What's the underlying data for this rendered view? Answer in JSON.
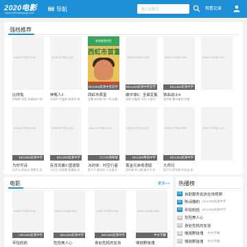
{
  "header": {
    "logo_main": "2020电影",
    "logo_sub": "www.2020dianying.com",
    "nav_label": "导航",
    "search_placeholder": "输入关键词",
    "history_label": "观看记录"
  },
  "featured": {
    "title": "强档推荐",
    "row1": [
      {
        "title": "比得兔",
        "actors": "詹姆斯·柯登,多姆纳尔·格",
        "badge": "",
        "watermark": "www.370dy.com"
      },
      {
        "title": "伸冤人2",
        "actors": "丹泽尔·华盛顿,佩德罗·帕",
        "badge": "",
        "watermark": "www.370dy.com"
      },
      {
        "title": "西虹市首富",
        "actors": "沈腾,宋芸桦,张一鸣,张晨",
        "badge": "BD1280高清中英双字",
        "poster": {
          "tagline": "有钱就是任性",
          "title": "西虹市首富"
        }
      },
      {
        "title": "碟中谍6：全面瓦解",
        "actors": "汤姆·克鲁斯,亨利·卡维尔",
        "badge": "BD1280高清中英双字",
        "watermark": "www.370dy.com"
      },
      {
        "title": "铁血战士4",
        "actors": "波伊德·霍布鲁克,特雷·",
        "badge": "BD1280高清中字",
        "watermark": "www.370dy.com"
      },
      {
        "title": "",
        "actors": "",
        "badge": "",
        "watermark": "www.370dy.com"
      }
    ],
    "row2": [
      {
        "title": "为你写诗",
        "actors": "吴亦凡,郭采洁,周德华,苏",
        "badge": "BD1280高清中字",
        "watermark": "www.370dy.com"
      },
      {
        "title": "反贪风暴3 国语版",
        "actors": "古天乐,张智霖,郑嘉颖,邓",
        "badge": "BD1280高清中字",
        "watermark": "www.370dy.com"
      },
      {
        "title": "冰封侠：时空行者",
        "actors": "甄子丹,黄圣依,王宝强,任",
        "badge": "TC720清晰版",
        "watermark": "www.370dy.com"
      },
      {
        "title": "黄金兄弟粤语版",
        "actors": "郑伊健,陈小春,谢天华,钱",
        "badge": "BD1280粤语中字",
        "watermark": "www.370dy.com"
      },
      {
        "title": "大师兄",
        "actors": "甄子丹,周秀娜,刘浩龙,朱",
        "badge": "BD1280高清中字",
        "watermark": "www.370dy.com"
      },
      {
        "title": "",
        "actors": "",
        "badge": "",
        "watermark": "www.370dy.com"
      }
    ]
  },
  "movies": {
    "title": "电影",
    "more_label": "更多>>",
    "cards": [
      {
        "title": "年轻妈妈",
        "badge": "HD1280高清中字",
        "watermark": "www.370dy.com"
      },
      {
        "title": "危险美人心",
        "badge": "BD1280高清中字",
        "watermark": "www.370dy.com"
      },
      {
        "title": "身处危机的女孩",
        "badge": "BD1280高清中字",
        "watermark": "www.370dy.com"
      },
      {
        "title": "情挑野玫瑰",
        "badge": "中文字幕",
        "watermark": "www.370dy.com"
      }
    ]
  },
  "hot": {
    "title": "热播榜",
    "items": [
      {
        "num": "01",
        "label": "自助服务女孩在线视频",
        "hot": true
      },
      {
        "num": "02",
        "label": "陈诗雅的",
        "tag": "HD1280高清中字",
        "hot": true
      },
      {
        "num": "03",
        "label": "年轻妈妈",
        "tag": "BD1280高清中字",
        "hot": true
      },
      {
        "num": "04",
        "label": "危险美人心",
        "hot": false
      },
      {
        "num": "05",
        "label": "身处危机的女孩",
        "hot": false
      },
      {
        "num": "06",
        "label": "情挑野玫瑰",
        "tag": "中文字幕",
        "hot": false
      },
      {
        "num": "07",
        "label": "情挑野玫瑰",
        "tag": "中文字幕",
        "hot": false
      }
    ]
  },
  "colors": {
    "brand": "#1c8fd6",
    "badge": "#666666"
  }
}
